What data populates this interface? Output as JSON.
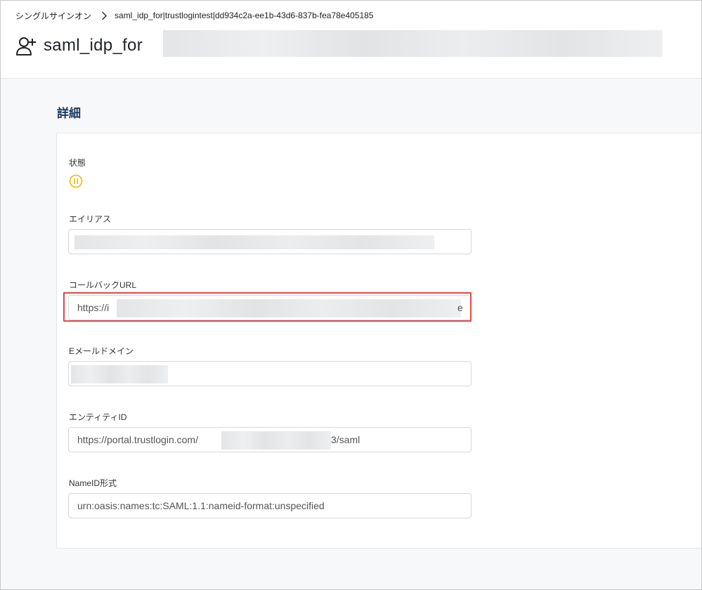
{
  "breadcrumb": {
    "root": "シングルサインオン",
    "current": "saml_idp_for|trustlogintest|dd934c2a-ee1b-43d6-837b-fea78e405185"
  },
  "page": {
    "title": "saml_idp_for"
  },
  "section": {
    "title": "詳細"
  },
  "fields": {
    "status_label": "状態",
    "alias_label": "エイリアス",
    "callback_label": "コールバックURL",
    "callback_value_prefix": "https://i",
    "callback_value_suffix": "e",
    "email_domain_label": "Eメールドメイン",
    "entity_id_label": "エンティティID",
    "entity_id_prefix": "https://portal.trustlogin.com/",
    "entity_id_suffix": "3/saml",
    "nameid_label": "NameID形式",
    "nameid_value": "urn:oasis:names:tc:SAML:1.1:nameid-format:unspecified"
  },
  "colors": {
    "status_icon": "#e8c21b",
    "highlight_border": "#e04848",
    "section_title": "#1b3a5c"
  },
  "icons": {
    "breadcrumb_separator": "chevron-right-icon",
    "title_icon": "user-plus-icon",
    "status_icon": "pause-circle-icon"
  }
}
